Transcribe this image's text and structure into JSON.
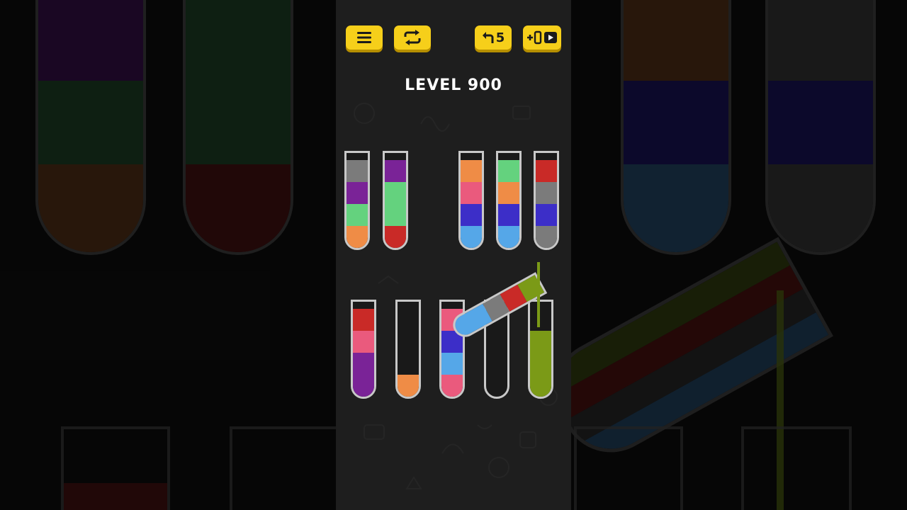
{
  "game": {
    "level_label": "LEVEL 900",
    "undo_count": "5"
  },
  "buttons": {
    "menu_icon": "menu-icon",
    "restart_icon": "restart-icon",
    "undo_icon": "undo-arrow-icon",
    "add_tube_icon": "add-tube-video-icon"
  },
  "colors": {
    "gray": "#7b7b7b",
    "purple": "#7a2397",
    "light_green": "#64d27e",
    "orange": "#ef8c46",
    "red": "#c92a27",
    "pink": "#ea5a7d",
    "blue": "#3c2ec8",
    "light_blue": "#55a7e8",
    "olive": "#7b9a17"
  },
  "tubes_top_row": [
    {
      "name": "tube-1",
      "layers_top_to_bottom": [
        "gray",
        "purple",
        "light_green",
        "orange"
      ]
    },
    {
      "name": "tube-2",
      "layers_top_to_bottom": [
        "purple",
        "light_green",
        "light_green",
        "red"
      ]
    },
    {
      "name": "tube-3",
      "layers_top_to_bottom": [
        "orange",
        "pink",
        "blue",
        "light_blue"
      ]
    },
    {
      "name": "tube-4",
      "layers_top_to_bottom": [
        "light_green",
        "orange",
        "blue",
        "light_blue"
      ]
    },
    {
      "name": "tube-5",
      "layers_top_to_bottom": [
        "red",
        "gray",
        "blue",
        "gray"
      ]
    }
  ],
  "tubes_bottom_row": [
    {
      "name": "tube-6",
      "layers_top_to_bottom": [
        "red",
        "pink",
        "purple",
        "purple"
      ]
    },
    {
      "name": "tube-7",
      "layers_top_to_bottom": [
        "orange"
      ]
    },
    {
      "name": "tube-8",
      "layers_top_to_bottom": [
        "pink",
        "blue",
        "light_blue",
        "pink"
      ]
    },
    {
      "name": "tube-9",
      "layers_top_to_bottom": []
    },
    {
      "name": "tube-10",
      "layers_top_to_bottom": [
        "olive",
        "olive",
        "olive"
      ]
    }
  ],
  "pouring_tube": {
    "layers_top_to_bottom": [
      "olive",
      "red",
      "gray",
      "light_blue"
    ],
    "target": "tube-10"
  }
}
